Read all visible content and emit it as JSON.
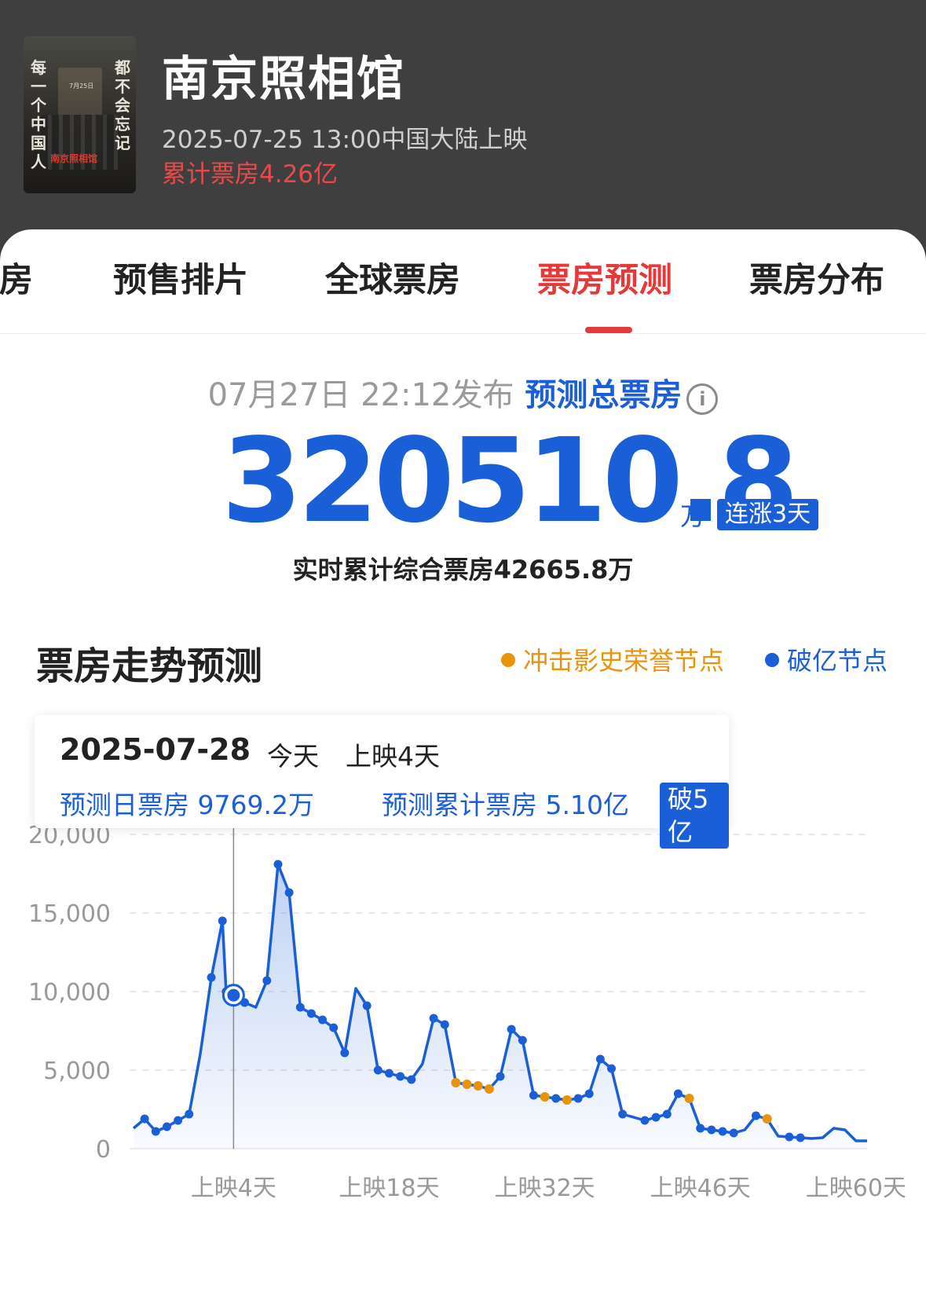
{
  "movie": {
    "title": "南京照相馆",
    "release": "2025-07-25 13:00中国大陆上映",
    "cumulative": "累计票房4.26亿",
    "poster_left_text": "每一个中国人",
    "poster_right_text": "都不会忘记",
    "poster_title": "南京照相馆",
    "poster_date": "7月25日"
  },
  "tabs": [
    "票房",
    "预售排片",
    "全球票房",
    "票房预测",
    "票房分布"
  ],
  "active_tab": "票房预测",
  "forecast": {
    "publish_time": "07月27日 22:12发布",
    "label": "预测总票房",
    "value": "320510.8",
    "unit": "万",
    "badge": "连涨3天",
    "realtime": "实时累计综合票房42665.8万"
  },
  "trend": {
    "title": "票房走势预测",
    "legend_honor": "冲击影史荣誉节点",
    "legend_billion": "破亿节点",
    "colors": {
      "primary": "#1a5fd8",
      "honor": "#e8930c",
      "accent": "#e33a3a"
    }
  },
  "tooltip": {
    "date": "2025-07-28",
    "today": "今天",
    "day": "上映4天",
    "daily": "预测日票房 9769.2万",
    "cumulative": "预测累计票房 5.10亿",
    "badge": "破5亿"
  },
  "chart_data": {
    "type": "line",
    "xlabel": "",
    "ylabel": "",
    "ylim": [
      0,
      20000
    ],
    "y_ticks": [
      "20,000",
      "15,000",
      "10,000",
      "5,000",
      "0"
    ],
    "x_ticks": [
      "上映4天",
      "上映18天",
      "上映32天",
      "上映46天",
      "上映60天"
    ],
    "x_tick_days": [
      4,
      18,
      32,
      46,
      60
    ],
    "grid": true,
    "selected_day": 4,
    "series": [
      {
        "days": [
          -5,
          -4,
          -3,
          -2,
          -1,
          0,
          1,
          2,
          3,
          3.33,
          4,
          5,
          6,
          7,
          8,
          9,
          10,
          11,
          12,
          13,
          14,
          15,
          16,
          17,
          18,
          19,
          20,
          21,
          22,
          23,
          24,
          25,
          26,
          27,
          28,
          29,
          30,
          31,
          32,
          33,
          34,
          35,
          36,
          37,
          38,
          39,
          40,
          41,
          42,
          43,
          44,
          45,
          46,
          47,
          48,
          49,
          50,
          51,
          52,
          53,
          54,
          55,
          56,
          57,
          58,
          59,
          60,
          61
        ],
        "values": [
          1300,
          1900,
          1100,
          1400,
          1800,
          2200,
          6000,
          10900,
          14500,
          10000,
          9770,
          9300,
          9000,
          10700,
          18100,
          16300,
          9000,
          8600,
          8200,
          7700,
          6100,
          10200,
          9100,
          5000,
          4800,
          4600,
          4400,
          5400,
          8300,
          7900,
          4200,
          4100,
          4000,
          3800,
          4600,
          7600,
          6900,
          3400,
          3300,
          3200,
          3100,
          3200,
          3500,
          5700,
          5100,
          2200,
          2000,
          1800,
          2000,
          2200,
          3500,
          3200,
          1300,
          1200,
          1100,
          1000,
          1200,
          2100,
          1900,
          800,
          750,
          700,
          650,
          700,
          1300,
          1200,
          500,
          500
        ],
        "honor_nodes": [
          30,
          31,
          32,
          33,
          38,
          40,
          51,
          58
        ],
        "billion_nodes": [
          1,
          2,
          3,
          4,
          5,
          7,
          8,
          9,
          10,
          11,
          13,
          14,
          15,
          16,
          17,
          18,
          19,
          20,
          22,
          23,
          24,
          25,
          26,
          28,
          29,
          34,
          35,
          36,
          37,
          39,
          41,
          42,
          43,
          44,
          45,
          47,
          48,
          49,
          50,
          52,
          53,
          54,
          55,
          57,
          60,
          61
        ]
      }
    ]
  }
}
